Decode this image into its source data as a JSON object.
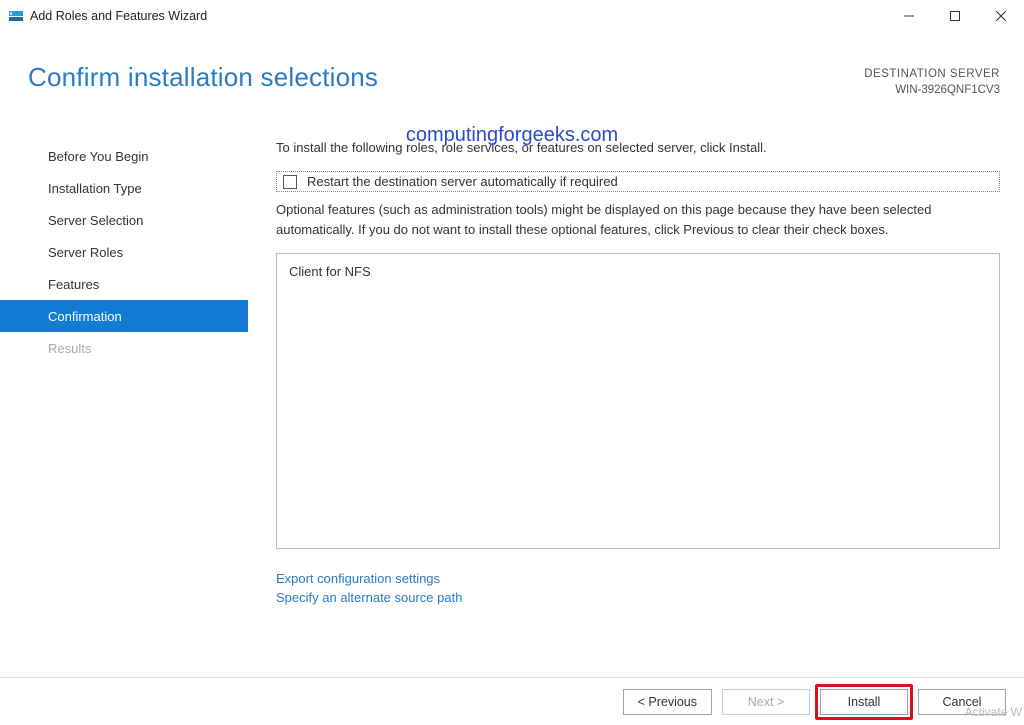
{
  "window": {
    "title": "Add Roles and Features Wizard"
  },
  "header": {
    "title": "Confirm installation selections",
    "destination_label": "DESTINATION SERVER",
    "destination_value": "WIN-3926QNF1CV3"
  },
  "watermark": "computingforgeeks.com",
  "sidebar": {
    "items": [
      {
        "label": "Before You Begin",
        "active": false,
        "disabled": false
      },
      {
        "label": "Installation Type",
        "active": false,
        "disabled": false
      },
      {
        "label": "Server Selection",
        "active": false,
        "disabled": false
      },
      {
        "label": "Server Roles",
        "active": false,
        "disabled": false
      },
      {
        "label": "Features",
        "active": false,
        "disabled": false
      },
      {
        "label": "Confirmation",
        "active": true,
        "disabled": false
      },
      {
        "label": "Results",
        "active": false,
        "disabled": true
      }
    ]
  },
  "main": {
    "instruction": "To install the following roles, role services, or features on selected server, click Install.",
    "restart_checkbox_label": "Restart the destination server automatically if required",
    "optional_text": "Optional features (such as administration tools) might be displayed on this page because they have been selected automatically. If you do not want to install these optional features, click Previous to clear their check boxes.",
    "features_list": [
      "Client for NFS"
    ],
    "links": {
      "export": "Export configuration settings",
      "alt_source": "Specify an alternate source path"
    }
  },
  "footer": {
    "previous": "< Previous",
    "next": "Next >",
    "install": "Install",
    "cancel": "Cancel"
  },
  "activate_hint": "Activate W"
}
